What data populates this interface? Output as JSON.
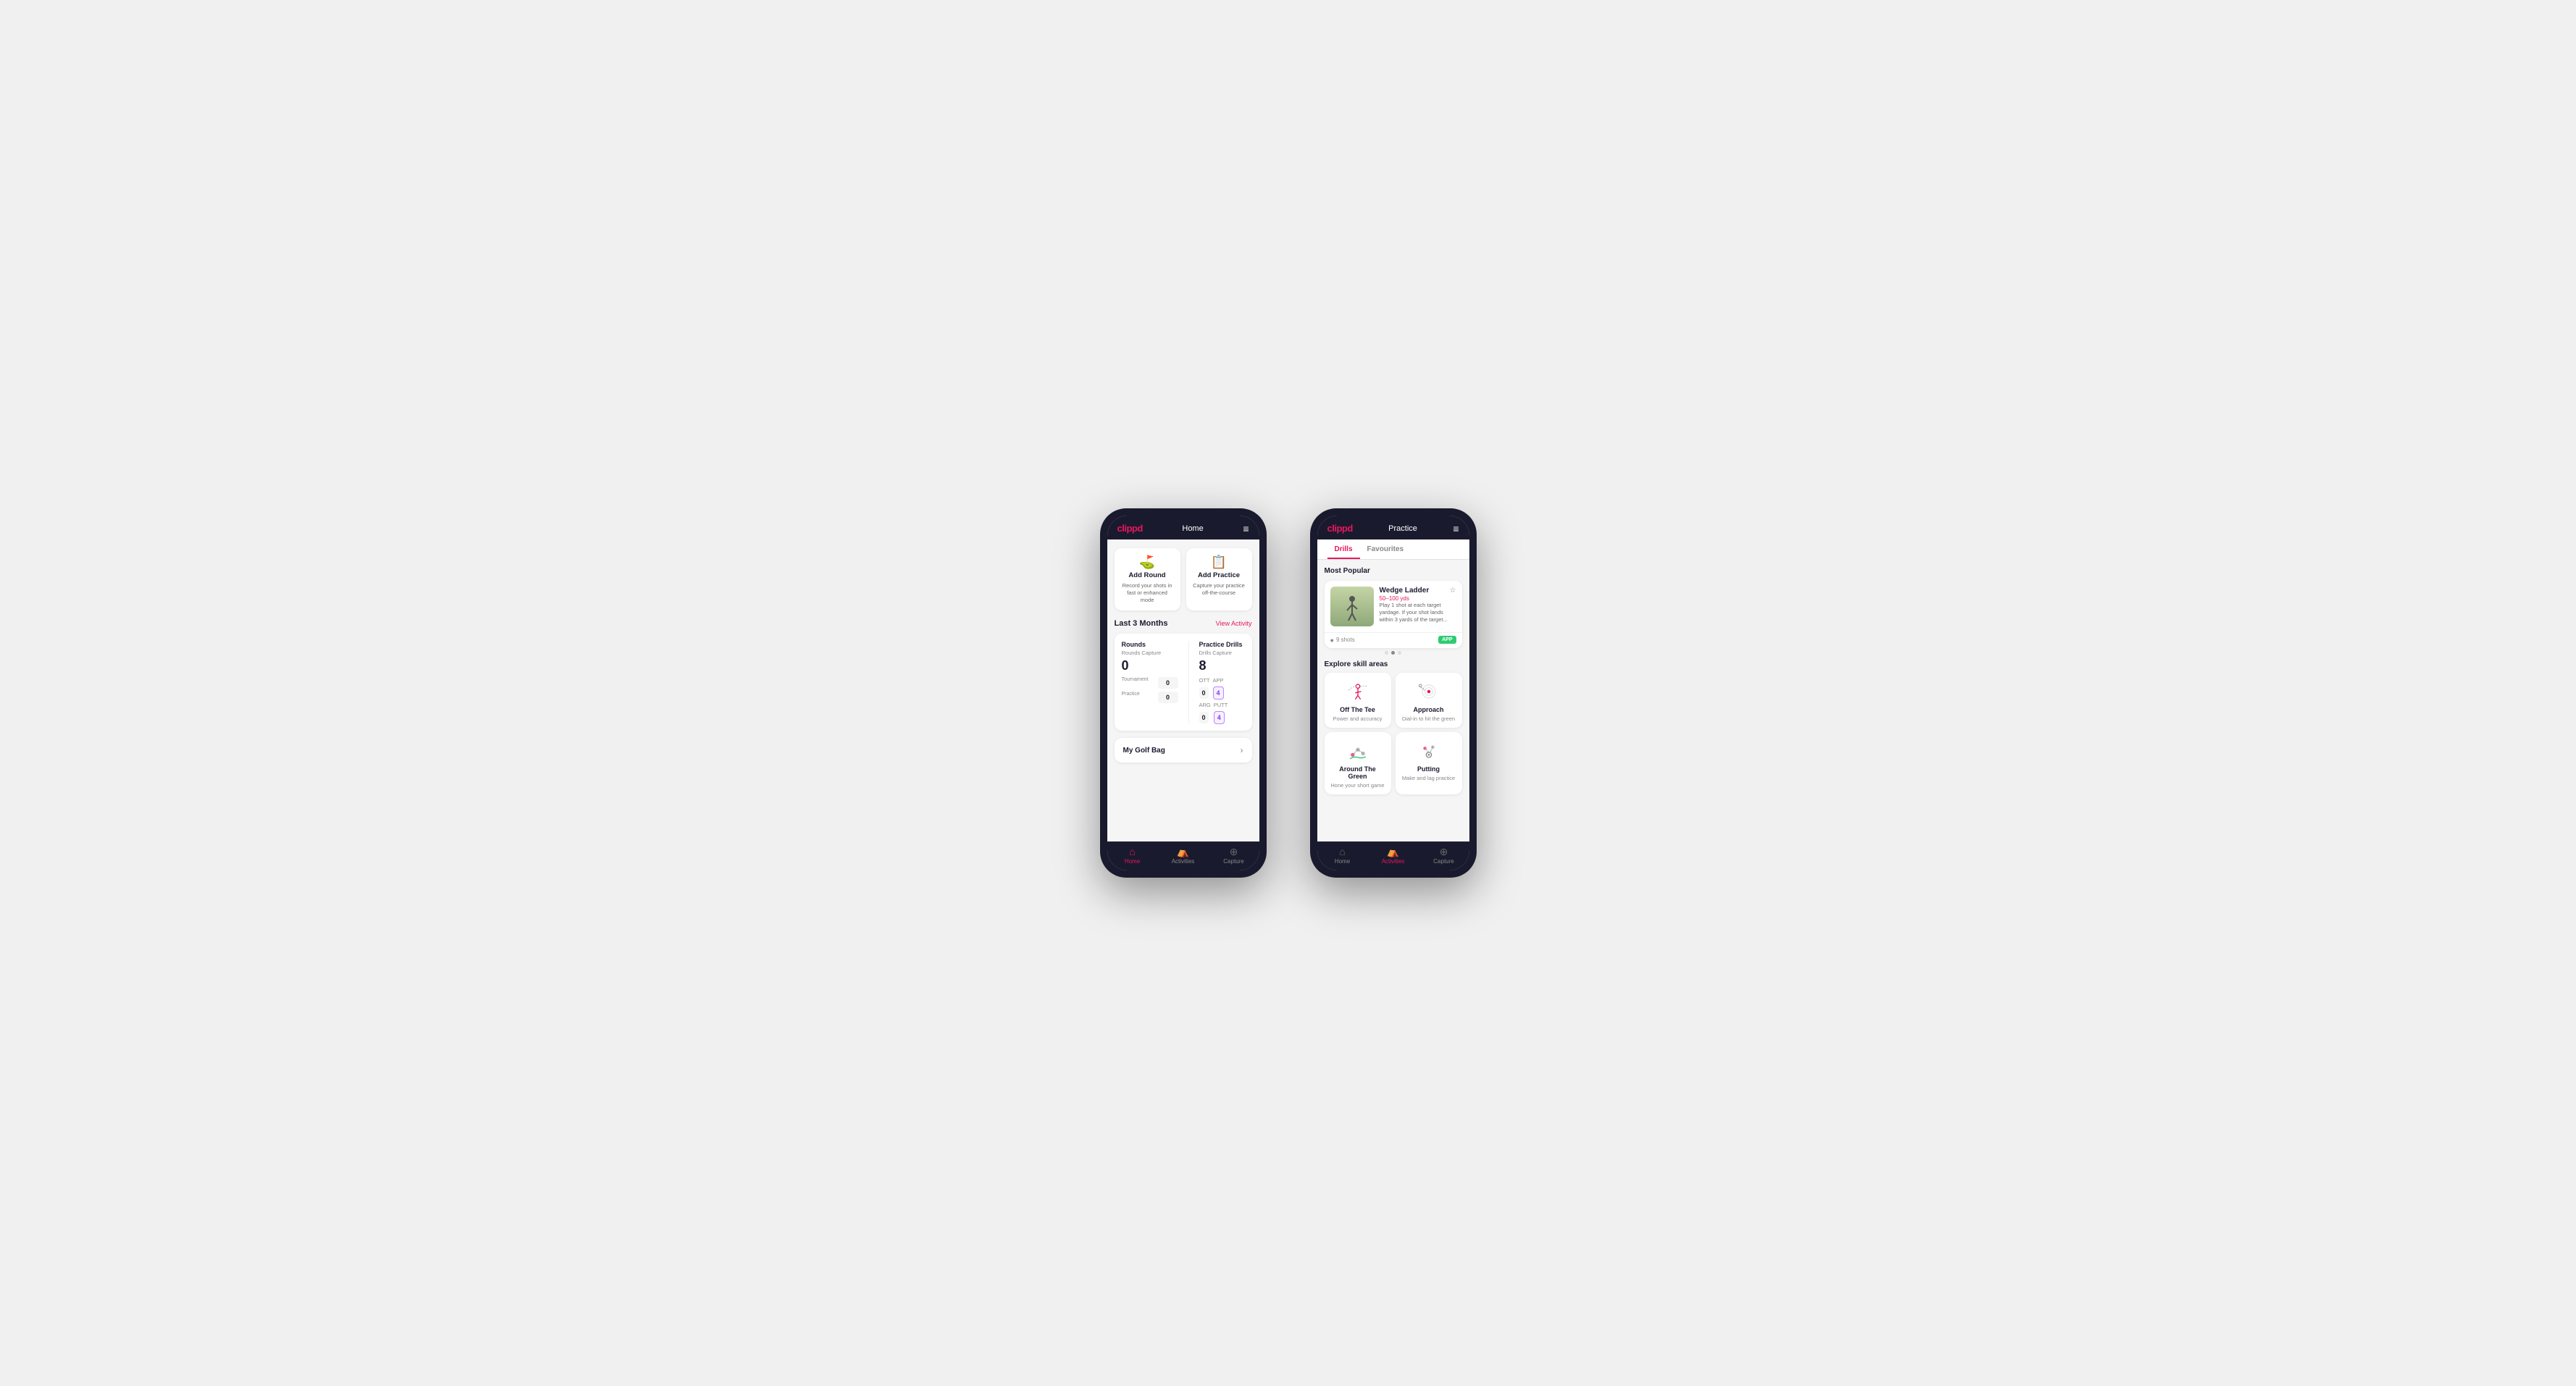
{
  "phone1": {
    "header": {
      "logo": "clippd",
      "title": "Home",
      "menu_icon": "≡"
    },
    "cards": [
      {
        "icon": "⛳",
        "title": "Add Round",
        "desc": "Record your shots in fast or enhanced mode"
      },
      {
        "icon": "📋",
        "title": "Add Practice",
        "desc": "Capture your practice off-the-course"
      }
    ],
    "activity_section": {
      "title": "Last 3 Months",
      "link": "View Activity"
    },
    "stats": {
      "rounds": {
        "title": "Rounds",
        "capture_label": "Rounds Capture",
        "big_number": "0",
        "rows": [
          {
            "label": "Tournament",
            "value": "0"
          },
          {
            "label": "Practice",
            "value": "0"
          }
        ]
      },
      "drills": {
        "title": "Practice Drills",
        "capture_label": "Drills Capture",
        "big_number": "8",
        "rows": [
          {
            "label": "OTT",
            "value": "0",
            "label2": "APP",
            "value2": "4",
            "highlight2": true
          },
          {
            "label": "ARG",
            "value": "0",
            "label2": "PUTT",
            "value2": "4",
            "highlight2": true
          }
        ]
      }
    },
    "golf_bag": {
      "label": "My Golf Bag",
      "chevron": "›"
    },
    "nav": [
      {
        "icon": "🏠",
        "label": "Home",
        "active": true
      },
      {
        "icon": "🏌️",
        "label": "Activities",
        "active": false
      },
      {
        "icon": "➕",
        "label": "Capture",
        "active": false
      }
    ]
  },
  "phone2": {
    "header": {
      "logo": "clippd",
      "title": "Practice",
      "menu_icon": "≡"
    },
    "tabs": [
      {
        "label": "Drills",
        "active": true
      },
      {
        "label": "Favourites",
        "active": false
      }
    ],
    "most_popular_label": "Most Popular",
    "drill_card": {
      "name": "Wedge Ladder",
      "distance": "50–100 yds",
      "desc": "Play 1 shot at each target yardage. If your shot lands within 3 yards of the target...",
      "shots": "9 shots",
      "badge": "APP"
    },
    "dots": [
      false,
      true,
      false
    ],
    "explore_label": "Explore skill areas",
    "skills": [
      {
        "name": "Off The Tee",
        "desc": "Power and accuracy",
        "icon_type": "tee"
      },
      {
        "name": "Approach",
        "desc": "Dial-in to hit the green",
        "icon_type": "approach"
      },
      {
        "name": "Around The Green",
        "desc": "Hone your short game",
        "icon_type": "around"
      },
      {
        "name": "Putting",
        "desc": "Make and lag practice",
        "icon_type": "putting"
      }
    ],
    "nav": [
      {
        "icon": "🏠",
        "label": "Home",
        "active": false
      },
      {
        "icon": "🏌️",
        "label": "Activities",
        "active": true
      },
      {
        "icon": "➕",
        "label": "Capture",
        "active": false
      }
    ]
  }
}
